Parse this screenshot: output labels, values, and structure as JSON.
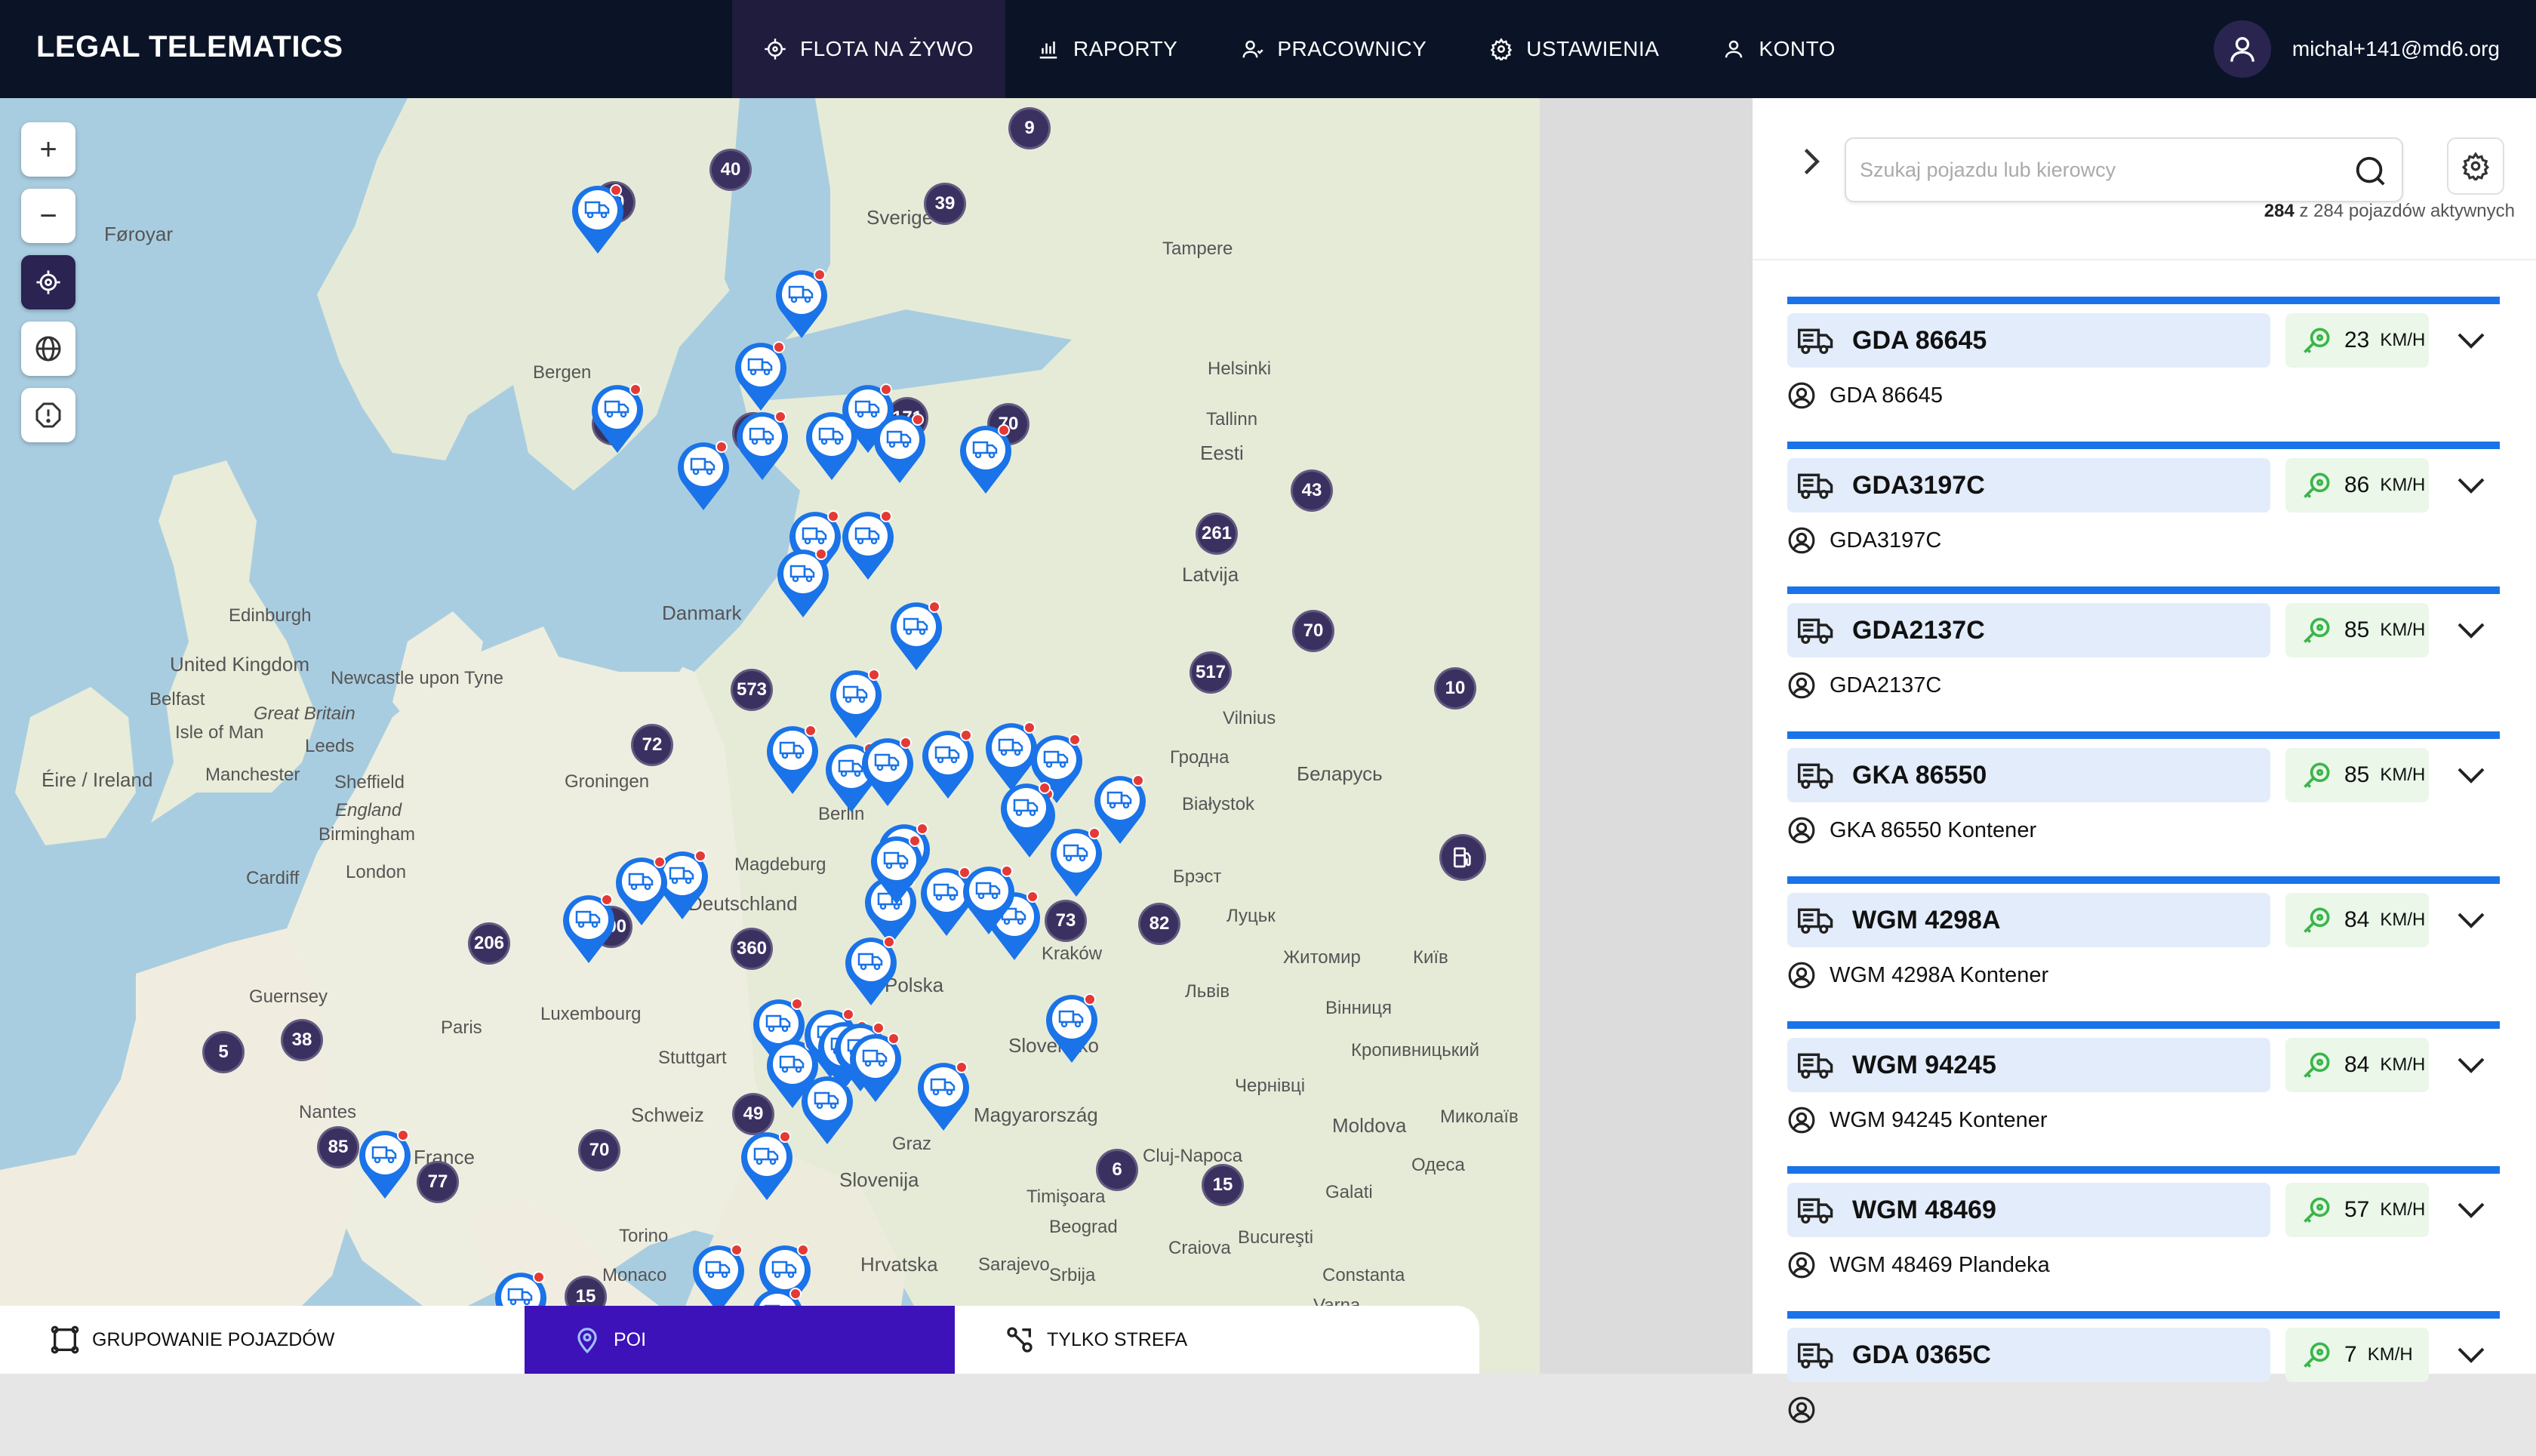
{
  "header": {
    "brand": "LEGAL TELEMATICS",
    "nav": [
      {
        "label": "FLOTA NA ŻYWO",
        "icon": "live-target-icon",
        "active": true
      },
      {
        "label": "RAPORTY",
        "icon": "bar-chart-icon",
        "active": false
      },
      {
        "label": "PRACOWNICY",
        "icon": "employees-icon",
        "active": false
      },
      {
        "label": "USTAWIENIA",
        "icon": "gear-icon",
        "active": false
      },
      {
        "label": "KONTO",
        "icon": "user-icon",
        "active": false
      }
    ],
    "user_email": "michal+141@md6.org"
  },
  "map": {
    "controls": [
      "zoom-in",
      "zoom-out",
      "locate",
      "globe",
      "alert"
    ],
    "zoom_in_label": "+",
    "zoom_out_label": "−",
    "labels": [
      "Føroyar",
      "Bergen",
      "Sverige",
      "Tampere",
      "Helsinki",
      "Tallinn",
      "Eesti",
      "Latvija",
      "Danmark",
      "Edinburgh",
      "United Kingdom",
      "Great Britain",
      "Newcastle upon Tyne",
      "Belfast",
      "Isle of Man",
      "Leeds",
      "Éire / Ireland",
      "Manchester",
      "Sheffield",
      "England",
      "Birmingham",
      "Cardiff",
      "London",
      "Groningen",
      "Magdeburg",
      "Deutschland",
      "Berlin",
      "Vilnius",
      "Гродна",
      "Беларусь",
      "Białystok",
      "Брэст",
      "Луцьк",
      "Житомир",
      "Київ",
      "Львів",
      "Вінниця",
      "Polska",
      "Slovensko",
      "Magyarország",
      "Moldova",
      "Кропивницький",
      "Чернівці",
      "Миколаїв",
      "Одеса",
      "Paris",
      "France",
      "Nantes",
      "Luxembourg",
      "Stuttgart",
      "Schweiz",
      "Slovenija",
      "Hrvatska",
      "Monaco",
      "Torino",
      "Sarajevo",
      "Srbija",
      "Beograd",
      "Craiova",
      "Bucureşti",
      "Galati",
      "Constanta",
      "Varna",
      "Cluj-Napoca",
      "Timişoara",
      "Guernsey",
      "Graz",
      "Kraków"
    ],
    "clusters": [
      "9",
      "40",
      "40",
      "39",
      "86",
      "220",
      "171",
      "70",
      "43",
      "261",
      "70",
      "517",
      "573",
      "10",
      "72",
      "82",
      "73",
      "360",
      "206",
      "300",
      "5",
      "38",
      "85",
      "70",
      "77",
      "6",
      "15",
      "15",
      "49"
    ]
  },
  "bottom_tabs": [
    {
      "label": "GRUPOWANIE POJAZDÓW",
      "icon": "grouping-icon",
      "active": false
    },
    {
      "label": "POI",
      "icon": "location-pin-icon",
      "active": true
    },
    {
      "label": "TYLKO STREFA",
      "icon": "zone-icon",
      "active": false
    }
  ],
  "panel": {
    "search_placeholder": "Szukaj pojazdu lub kierowcy",
    "active_count": "284",
    "active_suffix": "z 284 pojazdów aktywnych",
    "vehicles": [
      {
        "plate": "GDA 86645",
        "speed": "23",
        "unit": "KM/H",
        "driver": "GDA 86645"
      },
      {
        "plate": "GDA3197C",
        "speed": "86",
        "unit": "KM/H",
        "driver": "GDA3197C"
      },
      {
        "plate": "GDA2137C",
        "speed": "85",
        "unit": "KM/H",
        "driver": "GDA2137C"
      },
      {
        "plate": "GKA 86550",
        "speed": "85",
        "unit": "KM/H",
        "driver": "GKA 86550 Kontener"
      },
      {
        "plate": "WGM 4298A",
        "speed": "84",
        "unit": "KM/H",
        "driver": "WGM 4298A Kontener"
      },
      {
        "plate": "WGM 94245",
        "speed": "84",
        "unit": "KM/H",
        "driver": "WGM 94245 Kontener"
      },
      {
        "plate": "WGM 48469",
        "speed": "57",
        "unit": "KM/H",
        "driver": "WGM 48469 Plandeka"
      },
      {
        "plate": "GDA 0365C",
        "speed": "7",
        "unit": "KM/H",
        "driver": ""
      }
    ]
  }
}
